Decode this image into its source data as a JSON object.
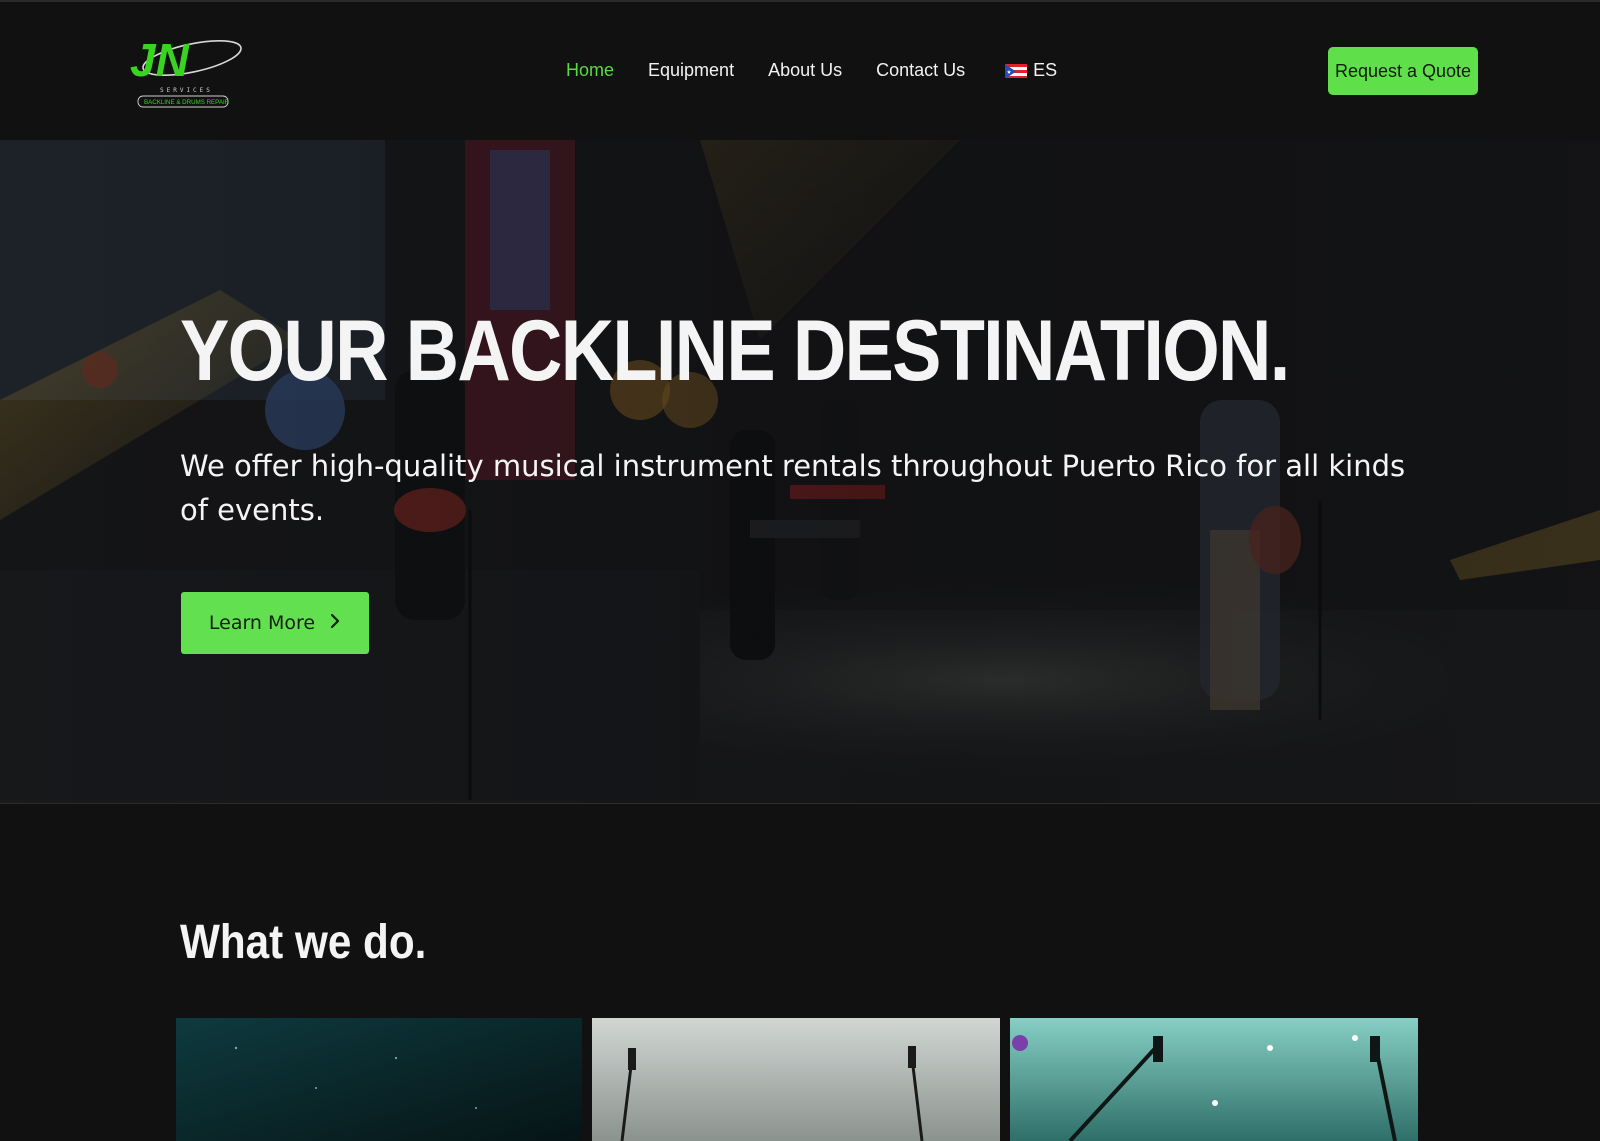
{
  "brand": {
    "logo_text": "JN",
    "logo_services": "SERVICES",
    "logo_tagline": "BACKLINE & DRUMS REPAIR",
    "accent": "#5fe04a"
  },
  "nav": {
    "items": [
      {
        "label": "Home",
        "active": true
      },
      {
        "label": "Equipment",
        "active": false
      },
      {
        "label": "About Us",
        "active": false
      },
      {
        "label": "Contact Us",
        "active": false
      }
    ],
    "language": {
      "label": "ES",
      "flag_icon": "puerto-rico-flag-icon"
    }
  },
  "header": {
    "cta_label": "Request a Quote"
  },
  "hero": {
    "title": "YOUR BACKLINE DESTINATION.",
    "subtitle": "We offer high-quality musical instrument rentals throughout Puerto Rico for all kinds of events.",
    "button_label": "Learn More",
    "button_icon": "chevron-right-icon"
  },
  "section": {
    "title": "What we do."
  }
}
